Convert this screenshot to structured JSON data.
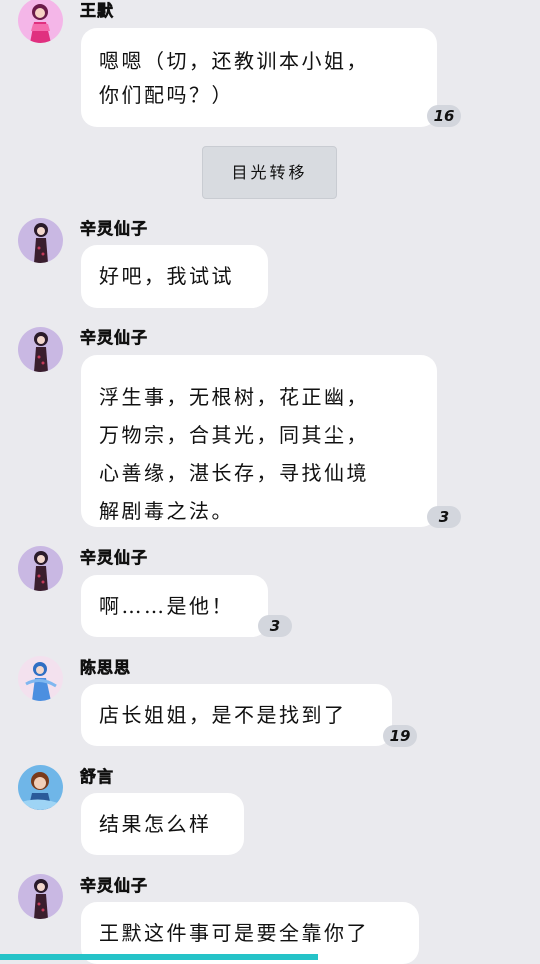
{
  "messages": [
    {
      "sender": "王默",
      "avatar": "pink-girl-avatar",
      "lines": [
        "嗯嗯（切，还教训本小姐，",
        "你们配吗？）"
      ],
      "count": "16"
    },
    {
      "sender": "辛灵仙子",
      "avatar": "fairy-avatar",
      "lines": [
        "好吧，我试试"
      ],
      "count": ""
    },
    {
      "sender": "辛灵仙子",
      "avatar": "fairy-avatar",
      "lines": [
        "浮生事，无根树，花正幽，",
        "万物宗，合其光，同其尘，",
        "心善缘，湛长存，寻找仙境",
        "解剧毒之法。"
      ],
      "count": "3"
    },
    {
      "sender": "辛灵仙子",
      "avatar": "fairy-avatar",
      "lines": [
        "啊……是他！"
      ],
      "count": "3"
    },
    {
      "sender": "陈思思",
      "avatar": "blue-girl-avatar",
      "lines": [
        "店长姐姐，是不是找到了"
      ],
      "count": "19"
    },
    {
      "sender": "舒言",
      "avatar": "boy-avatar",
      "lines": [
        "结果怎么样"
      ],
      "count": ""
    },
    {
      "sender": "辛灵仙子",
      "avatar": "fairy-avatar",
      "lines": [
        "王默这件事可是要全靠你了"
      ],
      "count": ""
    }
  ],
  "system_message": "目光转移",
  "colors": {
    "background": "#eaeaee",
    "bubble": "#ffffff",
    "count_badge": "#d3d6dd",
    "bottom_bar": "#25c3c8"
  }
}
